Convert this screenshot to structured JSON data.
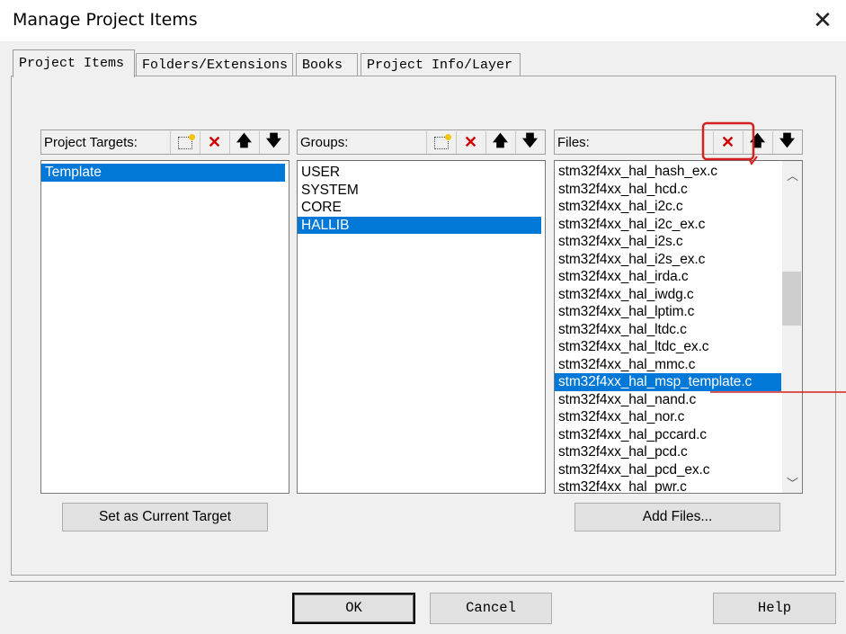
{
  "window": {
    "title": "Manage Project Items",
    "close_icon": "close-icon"
  },
  "tabs": [
    {
      "label": "Project Items",
      "active": true
    },
    {
      "label": "Folders/Extensions",
      "active": false
    },
    {
      "label": "Books",
      "active": false
    },
    {
      "label": "Project Info/Layer",
      "active": false
    }
  ],
  "targets": {
    "header": "Project Targets:",
    "items": [
      "Template"
    ],
    "selected": "Template",
    "set_current_button": "Set as Current Target"
  },
  "groups": {
    "header": "Groups:",
    "items": [
      "USER",
      "SYSTEM",
      "CORE",
      "HALLIB"
    ],
    "selected": "HALLIB"
  },
  "files": {
    "header": "Files:",
    "items": [
      "stm32f4xx_hal_hash_ex.c",
      "stm32f4xx_hal_hcd.c",
      "stm32f4xx_hal_i2c.c",
      "stm32f4xx_hal_i2c_ex.c",
      "stm32f4xx_hal_i2s.c",
      "stm32f4xx_hal_i2s_ex.c",
      "stm32f4xx_hal_irda.c",
      "stm32f4xx_hal_iwdg.c",
      "stm32f4xx_hal_lptim.c",
      "stm32f4xx_hal_ltdc.c",
      "stm32f4xx_hal_ltdc_ex.c",
      "stm32f4xx_hal_mmc.c",
      "stm32f4xx_hal_msp_template.c",
      "stm32f4xx_hal_nand.c",
      "stm32f4xx_hal_nor.c",
      "stm32f4xx_hal_pccard.c",
      "stm32f4xx_hal_pcd.c",
      "stm32f4xx_hal_pcd_ex.c",
      "stm32f4xx_hal_pwr.c"
    ],
    "selected": "stm32f4xx_hal_msp_template.c",
    "add_files_button": "Add Files..."
  },
  "footer": {
    "ok": "OK",
    "cancel": "Cancel",
    "help": "Help"
  },
  "colors": {
    "selection": "#0078d7",
    "delete_icon": "#d10000",
    "annotation": "#d42020"
  }
}
